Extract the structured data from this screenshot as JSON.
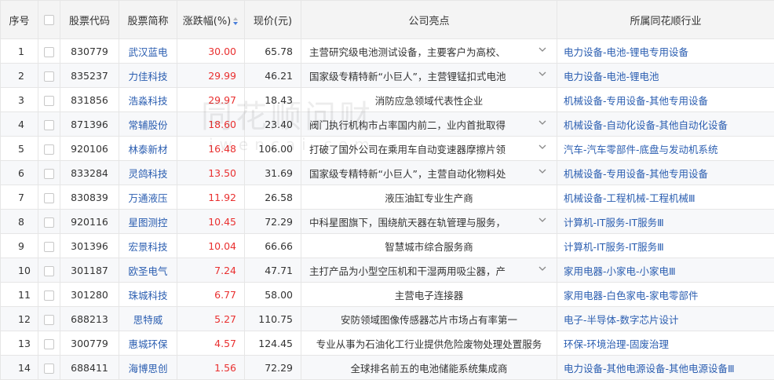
{
  "headers": {
    "index": "序号",
    "code": "股票代码",
    "name": "股票简称",
    "change": "涨跌幅(%)",
    "price": "现价(元)",
    "highlight": "公司亮点",
    "industry": "所属同花顺行业"
  },
  "watermark": {
    "brand": "同花顺问财",
    "url": "iwencai.com"
  },
  "colors": {
    "up": "#e93030",
    "link": "#2a5db0",
    "header_bg": "#f4f4f4",
    "stripe": "#f7f8fa"
  },
  "rows": [
    {
      "idx": "1",
      "code": "830779",
      "name": "武汉蓝电",
      "change": "30.00",
      "price": "65.78",
      "highlight": "主营研究级电池测试设备，主要客户为高校、",
      "expandable": true,
      "industry": "电力设备-电池-锂电专用设备"
    },
    {
      "idx": "2",
      "code": "835237",
      "name": "力佳科技",
      "change": "29.99",
      "price": "46.21",
      "highlight": "国家级专精特新“小巨人”，主营锂锰扣式电池",
      "expandable": true,
      "industry": "电力设备-电池-锂电池"
    },
    {
      "idx": "3",
      "code": "831856",
      "name": "浩淼科技",
      "change": "29.97",
      "price": "18.43",
      "highlight": "消防应急领域代表性企业",
      "expandable": false,
      "industry": "机械设备-专用设备-其他专用设备"
    },
    {
      "idx": "4",
      "code": "871396",
      "name": "常辅股份",
      "change": "18.60",
      "price": "23.40",
      "highlight": "阀门执行机构市占率国内前二，业内首批取得",
      "expandable": true,
      "industry": "机械设备-自动化设备-其他自动化设备"
    },
    {
      "idx": "5",
      "code": "920106",
      "name": "林泰新材",
      "change": "16.48",
      "price": "106.00",
      "highlight": "打破了国外公司在乘用车自动变速器摩擦片领",
      "expandable": true,
      "industry": "汽车-汽车零部件-底盘与发动机系统"
    },
    {
      "idx": "6",
      "code": "833284",
      "name": "灵鸽科技",
      "change": "13.50",
      "price": "31.69",
      "highlight": "国家级专精特新“小巨人”，主营自动化物料处",
      "expandable": true,
      "industry": "机械设备-专用设备-其他专用设备"
    },
    {
      "idx": "7",
      "code": "830839",
      "name": "万通液压",
      "change": "11.92",
      "price": "26.58",
      "highlight": "液压油缸专业生产商",
      "expandable": false,
      "industry": "机械设备-工程机械-工程机械Ⅲ"
    },
    {
      "idx": "8",
      "code": "920116",
      "name": "星图测控",
      "change": "10.45",
      "price": "72.29",
      "highlight": "中科星图旗下，围绕航天器在轨管理与服务，",
      "expandable": true,
      "industry": "计算机-IT服务-IT服务Ⅲ"
    },
    {
      "idx": "9",
      "code": "301396",
      "name": "宏景科技",
      "change": "10.04",
      "price": "66.66",
      "highlight": "智慧城市综合服务商",
      "expandable": false,
      "industry": "计算机-IT服务-IT服务Ⅲ"
    },
    {
      "idx": "10",
      "code": "301187",
      "name": "欧圣电气",
      "change": "7.24",
      "price": "47.71",
      "highlight": "主打产品为小型空压机和干湿两用吸尘器，产",
      "expandable": true,
      "industry": "家用电器-小家电-小家电Ⅲ"
    },
    {
      "idx": "11",
      "code": "301280",
      "name": "珠城科技",
      "change": "6.77",
      "price": "58.00",
      "highlight": "主营电子连接器",
      "expandable": false,
      "industry": "家用电器-白色家电-家电零部件"
    },
    {
      "idx": "12",
      "code": "688213",
      "name": "思特威",
      "change": "5.27",
      "price": "110.75",
      "highlight": "安防领域图像传感器芯片市场占有率第一",
      "expandable": false,
      "industry": "电子-半导体-数字芯片设计"
    },
    {
      "idx": "13",
      "code": "300779",
      "name": "惠城环保",
      "change": "4.57",
      "price": "124.45",
      "highlight": "专业从事为石油化工行业提供危险废物处理处置服务",
      "expandable": false,
      "industry": "环保-环境治理-固废治理"
    },
    {
      "idx": "14",
      "code": "688411",
      "name": "海博思创",
      "change": "1.56",
      "price": "72.29",
      "highlight": "全球排名前五的电池储能系统集成商",
      "expandable": false,
      "industry": "电力设备-其他电源设备-其他电源设备Ⅲ"
    }
  ]
}
